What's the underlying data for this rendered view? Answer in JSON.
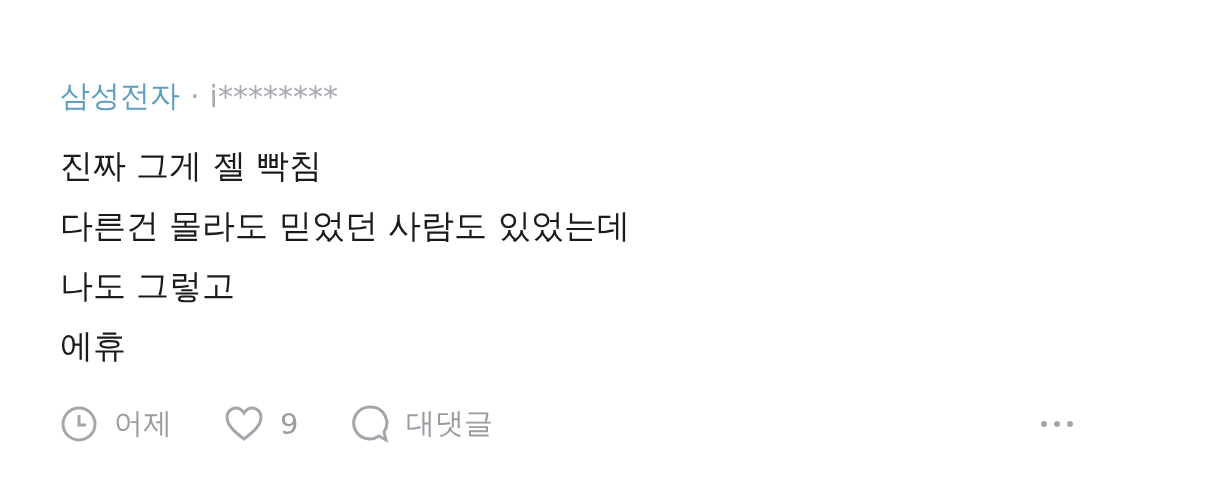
{
  "comment": {
    "company": "삼성전자",
    "separator": "·",
    "author": "i********",
    "lines": [
      "진짜 그게 젤 빡침",
      "다른건 몰라도 믿었던 사람도 있었는데",
      "나도 그렇고",
      "에휴"
    ],
    "time": "어제",
    "likes": "9",
    "reply_label": "대댓글"
  }
}
